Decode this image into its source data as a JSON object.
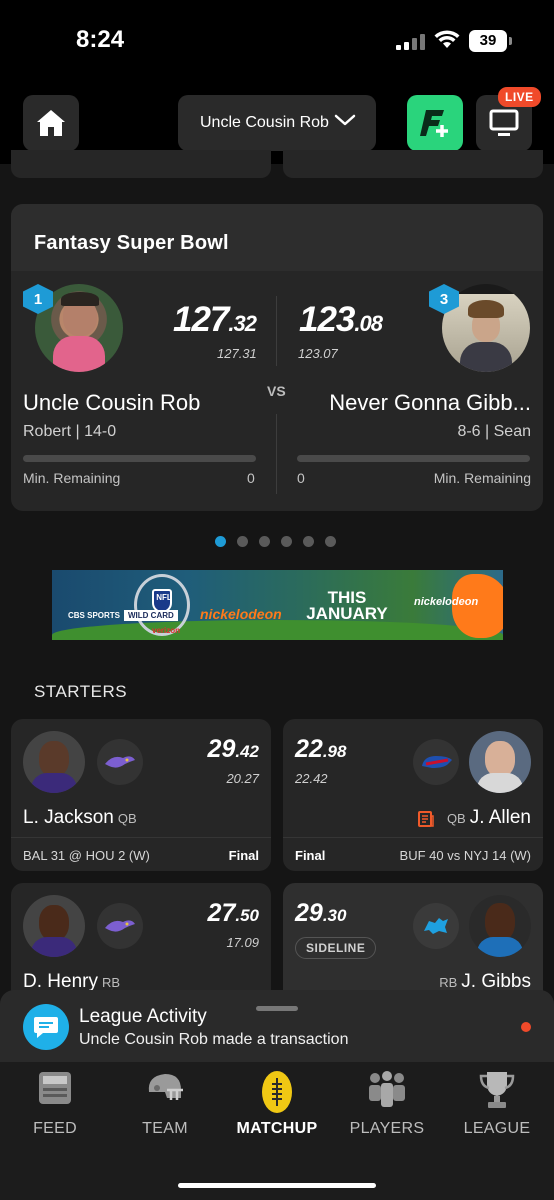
{
  "status_bar": {
    "time": "8:24",
    "battery": "39"
  },
  "header": {
    "team_select": "Uncle Cousin Rob",
    "live_badge": "LIVE"
  },
  "matchup": {
    "title": "Fantasy Super Bowl",
    "vs": "VS",
    "home": {
      "seed": "1",
      "score_int": "127",
      "score_dec": ".32",
      "projected": "127.31",
      "name": "Uncle Cousin Rob",
      "sub": "Robert | 14-0",
      "min_label": "Min. Remaining",
      "min_value": "0"
    },
    "away": {
      "seed": "3",
      "score_int": "123",
      "score_dec": ".08",
      "projected": "123.07",
      "name": "Never Gonna Gibb...",
      "sub": "8-6 | Sean",
      "min_label": "Min. Remaining",
      "min_value": "0"
    }
  },
  "carousel": {
    "count": 6,
    "active": 0
  },
  "ad": {
    "line1": "THIS",
    "line2": "JANUARY",
    "brand": "nickelodeon",
    "cbs": "CBS SPORTS",
    "wildcard": "WILD CARD",
    "verizon": "verizon",
    "nfl": "NFL"
  },
  "starters_label": "STARTERS",
  "players": [
    {
      "score_int": "29",
      "score_dec": ".42",
      "projected": "20.27",
      "name": "L. Jackson",
      "pos": "QB",
      "game": "BAL 31 @ HOU 2 (W)",
      "status": "Final",
      "team_colors": {
        "jersey": "#3b2a7a",
        "logo": "#7c5fd0"
      }
    },
    {
      "score_int": "22",
      "score_dec": ".98",
      "projected": "22.42",
      "name": "J. Allen",
      "pos": "QB",
      "game": "BUF 40 vs NYJ 14 (W)",
      "status": "Final",
      "team_colors": {
        "jersey": "#d8d8d8",
        "logo": "#c8102e"
      }
    },
    {
      "score_int": "27",
      "score_dec": ".50",
      "projected": "17.09",
      "name": "D. Henry",
      "pos": "RB",
      "team_colors": {
        "jersey": "#3b2a7a",
        "logo": "#7c5fd0"
      }
    },
    {
      "score_int": "29",
      "score_dec": ".30",
      "badge": "SIDELINE",
      "name": "J. Gibbs",
      "pos": "RB",
      "team_colors": {
        "jersey": "#1e6fb8",
        "logo": "#1ea0e0"
      }
    }
  ],
  "activity": {
    "title": "League Activity",
    "message": "Uncle Cousin Rob made a transaction"
  },
  "nav": {
    "items": [
      {
        "label": "FEED",
        "icon": "feed-icon"
      },
      {
        "label": "TEAM",
        "icon": "helmet-icon"
      },
      {
        "label": "MATCHUP",
        "icon": "football-icon",
        "active": true
      },
      {
        "label": "PLAYERS",
        "icon": "players-icon"
      },
      {
        "label": "LEAGUE",
        "icon": "trophy-icon"
      }
    ]
  },
  "colors": {
    "accent_blue": "#1e9bd6",
    "live_red": "#f04a2a",
    "action_green": "#2ad47c",
    "card_bg": "#262626"
  }
}
